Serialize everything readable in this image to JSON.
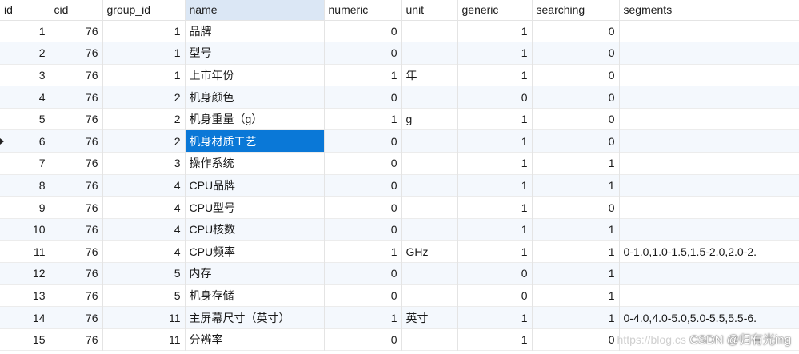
{
  "columns": [
    "id",
    "cid",
    "group_id",
    "name",
    "numeric",
    "unit",
    "generic",
    "searching",
    "segments"
  ],
  "rows": [
    [
      "1",
      "76",
      "1",
      "品牌",
      "0",
      "",
      "1",
      "0",
      ""
    ],
    [
      "2",
      "76",
      "1",
      "型号",
      "0",
      "",
      "1",
      "0",
      ""
    ],
    [
      "3",
      "76",
      "1",
      "上市年份",
      "1",
      "年",
      "1",
      "0",
      ""
    ],
    [
      "4",
      "76",
      "2",
      "机身颜色",
      "0",
      "",
      "0",
      "0",
      ""
    ],
    [
      "5",
      "76",
      "2",
      "机身重量（g）",
      "1",
      "g",
      "1",
      "0",
      ""
    ],
    [
      "6",
      "76",
      "2",
      "机身材质工艺",
      "0",
      "",
      "1",
      "0",
      ""
    ],
    [
      "7",
      "76",
      "3",
      "操作系统",
      "0",
      "",
      "1",
      "1",
      ""
    ],
    [
      "8",
      "76",
      "4",
      "CPU品牌",
      "0",
      "",
      "1",
      "1",
      ""
    ],
    [
      "9",
      "76",
      "4",
      "CPU型号",
      "0",
      "",
      "1",
      "0",
      ""
    ],
    [
      "10",
      "76",
      "4",
      "CPU核数",
      "0",
      "",
      "1",
      "1",
      ""
    ],
    [
      "11",
      "76",
      "4",
      "CPU频率",
      "1",
      "GHz",
      "1",
      "1",
      "0-1.0,1.0-1.5,1.5-2.0,2.0-2."
    ],
    [
      "12",
      "76",
      "5",
      "内存",
      "0",
      "",
      "0",
      "1",
      ""
    ],
    [
      "13",
      "76",
      "5",
      "机身存储",
      "0",
      "",
      "0",
      "1",
      ""
    ],
    [
      "14",
      "76",
      "11",
      "主屏幕尺寸（英寸）",
      "1",
      "英寸",
      "1",
      "1",
      "0-4.0,4.0-5.0,5.0-5.5,5.5-6."
    ],
    [
      "15",
      "76",
      "11",
      "分辨率",
      "0",
      "",
      "1",
      "0",
      ""
    ]
  ],
  "sorted_column": "name",
  "selected_row": 6,
  "selected_color": "#0a78d7",
  "watermark": {
    "faint_text": "https://blog.cs",
    "text": "CSDN @归有光ing"
  }
}
